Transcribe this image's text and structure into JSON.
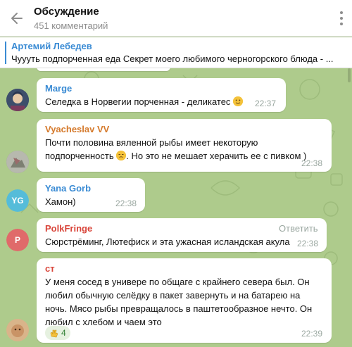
{
  "header": {
    "title": "Обсуждение",
    "subtitle": "451 комментарий"
  },
  "pinned": {
    "author": "Артемий Лебедев",
    "text": "Чуууть подпорченная еда  Секрет моего любимого черногорского блюда - ..."
  },
  "messages": [
    {
      "author": "Marge",
      "author_color": "#3a8bd4",
      "text": "Селедка в Норвегии порченная - деликатес",
      "time": "22:37",
      "avatar": "photo"
    },
    {
      "author": "Vyacheslav VV",
      "author_color": "#d57a2c",
      "line1": "Почти половина вяленной рыбы имеет некоторую",
      "line2a": "подпорченность",
      "line2b": ". Но это не мешает херачить ее с пивком )",
      "time": "22:38",
      "avatar": "photo"
    },
    {
      "author": "Yana Gorb",
      "author_color": "#3a8bd4",
      "text": "Хамон)",
      "time": "22:38",
      "avatar_initials": "YG",
      "avatar_color": "#55bcd9"
    },
    {
      "author": "PolkFringe",
      "author_color": "#d9453a",
      "text": "Сюрстрёминг, Лютефиск и эта ужасная исландская акула",
      "time": "22:38",
      "reply_label": "Ответить",
      "avatar_initials": "P",
      "avatar_color": "#e06a6a"
    },
    {
      "author": "ст",
      "author_color": "#d9453a",
      "lines": [
        "У меня сосед в универе по общаге с крайнего севера был. Он",
        "любил обычную селёдку в пакет завернуть и на батарею на",
        "ночь. Мясо рыбы превращалось в паштетообразное нечто. Он",
        "любил с хлебом и чаем это"
      ],
      "reaction_count": "4",
      "time": "22:39",
      "avatar": "photo"
    }
  ],
  "colors": {
    "accent": "#3a8bd4",
    "chat_background": "#aecb8c",
    "bubble": "#ffffff"
  },
  "icons": {
    "back": "arrow-left-icon",
    "menu": "more-vertical-icon",
    "emoji": "smiley-emoji",
    "reaction": "clap-emoji"
  }
}
